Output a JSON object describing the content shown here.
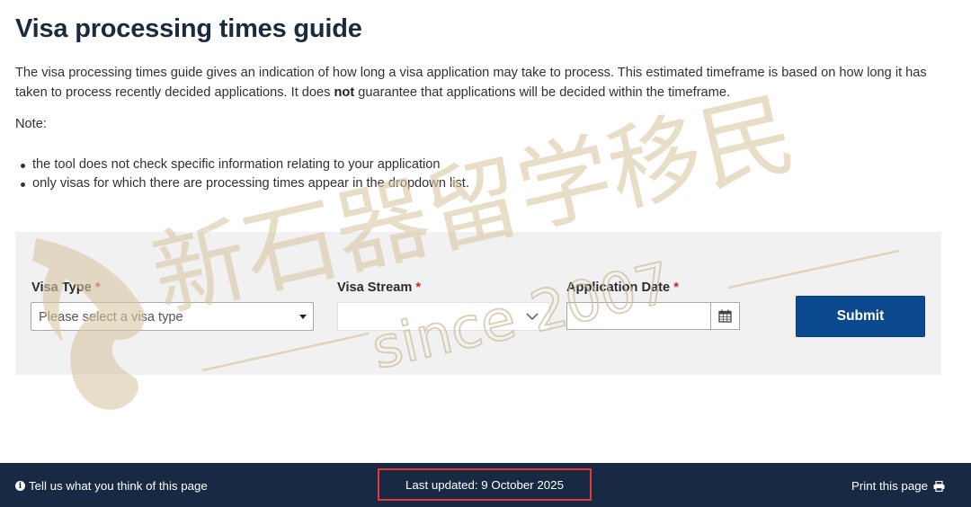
{
  "page": {
    "title": "Visa processing times guide",
    "intro_part1": "The visa processing times guide gives an indication of how long a visa application may take to process. This estimated timeframe is based on how long it has taken to process recently decided applications. It does ",
    "intro_bold": "not",
    "intro_part2": " guarantee that applications will be decided within the timeframe.",
    "note_label": "Note:",
    "notes": [
      "the tool does not check specific information relating to your application",
      "only visas for which there are processing times appear in the dropdown list."
    ]
  },
  "form": {
    "visa_type_label": "Visa Type",
    "visa_type_placeholder": "Please select a visa type",
    "visa_stream_label": "Visa Stream",
    "application_date_label": "Application Date",
    "required_marker": "*",
    "submit_label": "Submit"
  },
  "footer": {
    "feedback_label": "Tell us what you think of this page",
    "last_updated": "Last updated: 9 October 2025",
    "print_label": "Print this page"
  },
  "watermark": {
    "chinese_text": "新石器留学移民",
    "since_text": "since 2007"
  },
  "icons": {
    "feedback": "info-icon",
    "visa_type_dropdown": "caret-down-icon",
    "visa_stream_dropdown": "chevron-down-icon",
    "date_picker": "calendar-icon",
    "print": "printer-icon"
  },
  "colors": {
    "title": "#1b2a3f",
    "submit_button": "#0b4a8e",
    "footer_background": "#182a43",
    "required_marker": "#c62828",
    "highlight_box": "#e53935",
    "watermark": "#d9c7a3"
  }
}
